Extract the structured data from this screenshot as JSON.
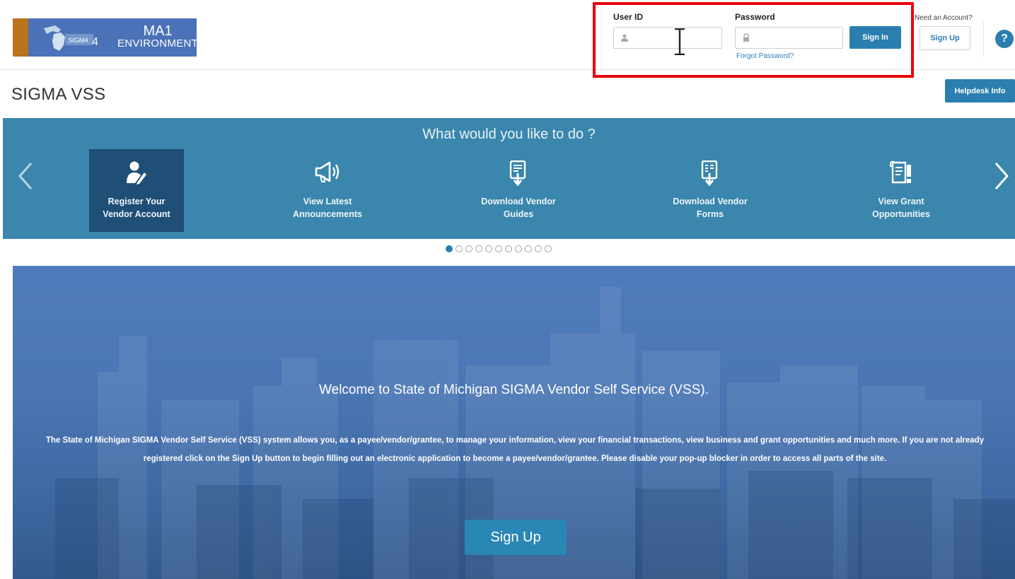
{
  "header": {
    "logo": {
      "line1": "MA1",
      "line2": "ENVIRONMENT",
      "mark_text": "SIGMA4"
    },
    "login": {
      "user_id_label": "User ID",
      "password_label": "Password",
      "user_id_value": "",
      "password_value": "",
      "sign_in_label": "Sign In",
      "forgot_password_label": "Forgot Password?"
    },
    "need_account_text": "Need an Account?",
    "sign_up_label": "Sign Up",
    "help_icon_glyph": "?"
  },
  "page": {
    "title": "SIGMA VSS",
    "helpdesk_label": "Helpdesk Info"
  },
  "carousel": {
    "heading": "What would you like to do ?",
    "items": [
      {
        "line1": "Register Your",
        "line2": "Vendor Account",
        "icon": "user-edit-icon",
        "active": true
      },
      {
        "line1": "View Latest",
        "line2": "Announcements",
        "icon": "megaphone-icon",
        "active": false
      },
      {
        "line1": "Download Vendor",
        "line2": "Guides",
        "icon": "document-download-icon",
        "active": false
      },
      {
        "line1": "Download Vendor",
        "line2": "Forms",
        "icon": "form-download-icon",
        "active": false
      },
      {
        "line1": "View Grant",
        "line2": "Opportunities",
        "icon": "grant-document-icon",
        "active": false
      }
    ],
    "page_count": 11,
    "current_page": 1
  },
  "hero": {
    "title": "Welcome to State of Michigan SIGMA Vendor Self Service (VSS).",
    "body": "The State of Michigan SIGMA Vendor Self Service (VSS) system allows you, as a payee/vendor/grantee, to manage your information, view your financial transactions, view business and grant opportunities and much more. If you are not already registered click on the Sign Up button to begin filling out an electronic application to become a payee/vendor/grantee. Please disable your pop-up blocker in order to access all parts of the site.",
    "sign_up_label": "Sign Up"
  },
  "colors": {
    "brand_blue": "#2a7fb0",
    "carousel_bg": "#3a86ac",
    "active_tile": "#1f4e77",
    "highlight_red": "#e8000b",
    "logo_bg": "#4b72b8",
    "logo_stripe": "#b8731c"
  }
}
